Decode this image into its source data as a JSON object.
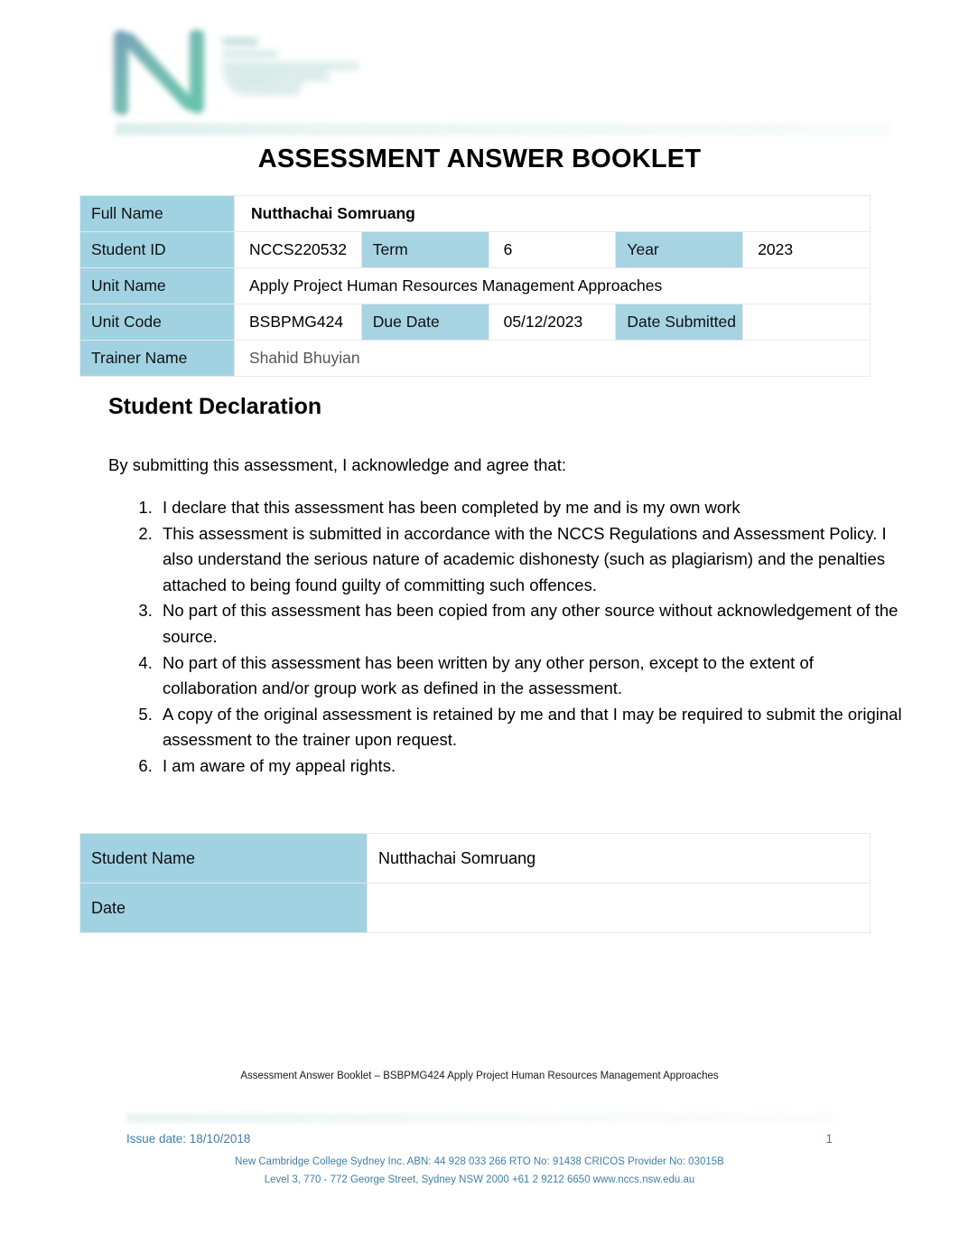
{
  "document": {
    "title": "ASSESSMENT ANSWER BOOKLET",
    "logo": {
      "mark": "letter-n-logo",
      "brand_color_blue": "#5d8ca8",
      "brand_color_teal": "#3fae9a"
    }
  },
  "info_table": {
    "rows": [
      {
        "label": "Full Name",
        "value": "Nutthachai Somruang"
      },
      {
        "label": "Student ID",
        "value": "NCCS220532",
        "label2": "Term",
        "value2": "6",
        "label3": "Year",
        "value3": "2023"
      },
      {
        "label": "Unit Name",
        "value": "Apply Project Human Resources Management Approaches"
      },
      {
        "label": "Unit Code",
        "value": "BSBPMG424",
        "label2": "Due Date",
        "value2": "05/12/2023",
        "label3": "Date Submitted",
        "value3": ""
      },
      {
        "label": "Trainer Name",
        "value": "Shahid Bhuyian"
      }
    ]
  },
  "declaration": {
    "heading": "Student Declaration",
    "intro": "By submitting this assessment, I acknowledge and agree that:",
    "items": [
      "I declare that this assessment has been completed by me and is my own work",
      "This assessment is submitted in accordance with the NCCS Regulations and Assessment Policy. I also understand the serious nature of academic dishonesty (such as plagiarism) and the penalties attached to being found guilty of committing such offences.",
      "No part of this assessment has been copied from any other source without acknowledgement of the source.",
      "No part of this assessment has been written by any other person, except to the extent of collaboration and/or group work as defined in the assessment.",
      "A copy of the original assessment is retained by me and that I may be required to submit the original assessment to the trainer upon request.",
      "I am aware of my appeal rights."
    ]
  },
  "signature_table": {
    "rows": [
      {
        "label": "Student Name",
        "value": "Nutthachai Somruang"
      },
      {
        "label": "Date",
        "value": ""
      }
    ]
  },
  "footer": {
    "note": "Assessment Answer Booklet – BSBPMG424 Apply Project Human Resources Management Approaches",
    "issue_date": "Issue date: 18/10/2018",
    "page_number": "1",
    "org_line": "New Cambridge College Sydney Inc. ABN: 44 928 033 266 RTO No: 91438 CRICOS Provider No: 03015B",
    "address_line": "Level 3, 770 - 772 George Street, Sydney NSW 2000 +61 2 9212 6650 www.nccs.nsw.edu.au",
    "accent_color": "#3f7fa6"
  }
}
